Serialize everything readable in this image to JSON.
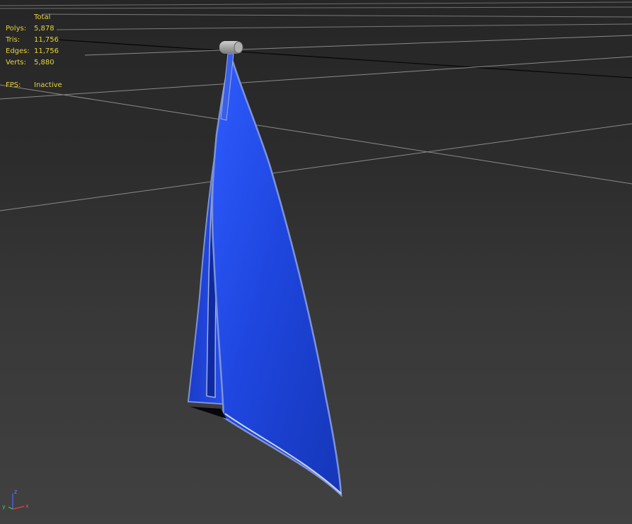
{
  "stats": {
    "header": "Total",
    "rows": [
      {
        "label": "Polys:",
        "value": "5,878"
      },
      {
        "label": "Tris:",
        "value": "11,756"
      },
      {
        "label": "Edges:",
        "value": "11,756"
      },
      {
        "label": "Verts:",
        "value": "5,880"
      }
    ],
    "fps": {
      "label": "FPS:",
      "value": "Inactive"
    }
  },
  "axis": {
    "x": "x",
    "y": "y",
    "z": "z"
  },
  "colors": {
    "stat_text": "#e8d23c",
    "towel_blue": "#1f47e0",
    "grid_line": "#8a8a8a",
    "axis_x": "#d23c3c",
    "axis_y": "#3cb43c",
    "axis_z": "#4060e0"
  }
}
